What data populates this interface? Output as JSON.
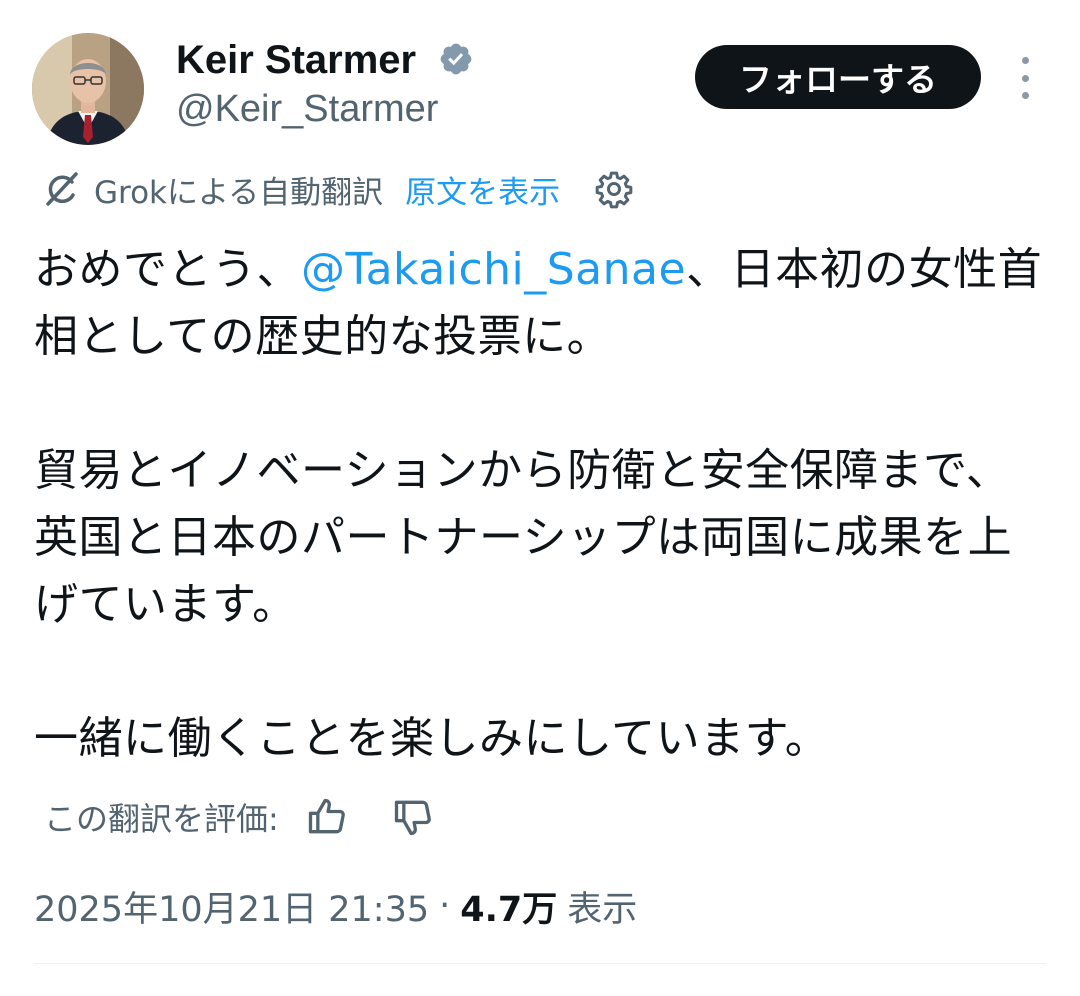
{
  "author": {
    "display_name": "Keir Starmer",
    "handle": "@Keir_Starmer",
    "verified": true
  },
  "actions": {
    "follow_label": "フォローする",
    "more_icon": "more-vertical-icon"
  },
  "translation": {
    "icon": "grok-icon",
    "label": "Grokによる自動翻訳",
    "show_original_label": "原文を表示",
    "settings_icon": "gear-icon"
  },
  "tweet": {
    "p1_before": "おめでとう、",
    "mention": "@Takaichi_Sanae",
    "p1_after": "、日本初の女性首相としての歴史的な投票に。",
    "p2": "貿易とイノベーションから防衛と安全保障まで、英国と日本のパートナーシップは両国に成果を上げています。",
    "p3": "一緒に働くことを楽しみにしています。"
  },
  "rating": {
    "label": "この翻訳を評価:",
    "like_icon": "thumbs-up-icon",
    "dislike_icon": "thumbs-down-icon"
  },
  "meta": {
    "timestamp": "2025年10月21日 21:35",
    "separator": "·",
    "views_count": "4.7万",
    "views_label": "表示"
  },
  "colors": {
    "text": "#0f1419",
    "secondary": "#536471",
    "link": "#1d9bf0",
    "follow_bg": "#0f1419",
    "verified": "#829aab"
  }
}
